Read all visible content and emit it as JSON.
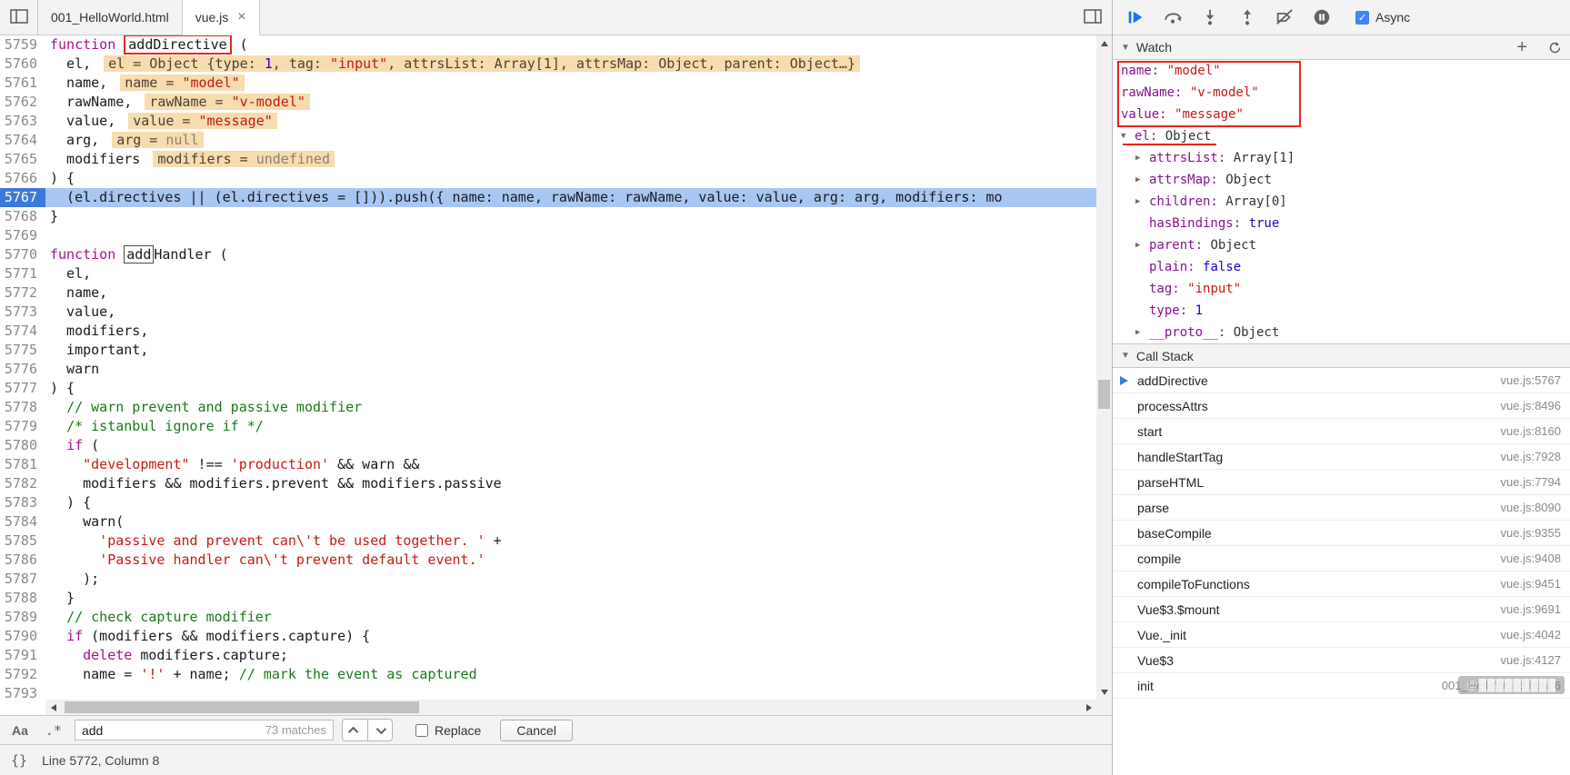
{
  "colors": {
    "annotation_red": "#E8271C",
    "execution_line_blue": "#A8C6F2",
    "current_line_gutter_blue": "#3D79D9",
    "resume_blue": "#1A73E8",
    "inline_hint_tan": "#F7DCAE"
  },
  "tabs": {
    "items": [
      {
        "label": "001_HelloWorld.html",
        "active": false
      },
      {
        "label": "vue.js",
        "active": true,
        "close": "×"
      }
    ]
  },
  "editor": {
    "current_line": 5767,
    "lines": [
      {
        "n": 5759,
        "seg": [
          [
            "function",
            "k"
          ],
          [
            " ",
            "d"
          ],
          [
            "addDirective",
            "annbox"
          ],
          [
            " (",
            "d"
          ]
        ]
      },
      {
        "n": 5760,
        "seg": [
          [
            "  el,",
            "d"
          ]
        ],
        "hint": [
          [
            "el = Object {type: ",
            "hd"
          ],
          [
            "1",
            "hn"
          ],
          [
            ", tag: ",
            "hd"
          ],
          [
            "\"input\"",
            "hs"
          ],
          [
            ", attrsList: Array[1], attrsMap: Object, parent: Object…}",
            "hd"
          ]
        ]
      },
      {
        "n": 5761,
        "seg": [
          [
            "  name,",
            "d"
          ]
        ],
        "hint": [
          [
            "name = ",
            "hd"
          ],
          [
            "\"model\"",
            "hs"
          ]
        ]
      },
      {
        "n": 5762,
        "seg": [
          [
            "  rawName,",
            "d"
          ]
        ],
        "hint": [
          [
            "rawName = ",
            "hd"
          ],
          [
            "\"v-model\"",
            "hs"
          ]
        ]
      },
      {
        "n": 5763,
        "seg": [
          [
            "  value,",
            "d"
          ]
        ],
        "hint": [
          [
            "value = ",
            "hd"
          ],
          [
            "\"message\"",
            "hs"
          ]
        ]
      },
      {
        "n": 5764,
        "seg": [
          [
            "  arg,",
            "d"
          ]
        ],
        "hint": [
          [
            "arg = ",
            "hd"
          ],
          [
            "null",
            "hg"
          ]
        ]
      },
      {
        "n": 5765,
        "seg": [
          [
            "  modifiers",
            "d"
          ]
        ],
        "hint": [
          [
            "modifiers = ",
            "hd"
          ],
          [
            "undefined",
            "hg"
          ]
        ]
      },
      {
        "n": 5766,
        "seg": [
          [
            ") {",
            "d"
          ]
        ]
      },
      {
        "n": 5767,
        "hl": true,
        "seg": [
          [
            "  (el.directives || (el.directives = [])).push({ name: name, rawName: rawName, value: value, arg: arg, modifiers: mo",
            "d"
          ]
        ]
      },
      {
        "n": 5768,
        "seg": [
          [
            "}",
            "d"
          ]
        ]
      },
      {
        "n": 5769,
        "seg": []
      },
      {
        "n": 5770,
        "seg": [
          [
            "function",
            "k"
          ],
          [
            " ",
            "d"
          ],
          [
            "add",
            "ring"
          ],
          [
            "Handler (",
            "d"
          ]
        ]
      },
      {
        "n": 5771,
        "seg": [
          [
            "  el,",
            "d"
          ]
        ]
      },
      {
        "n": 5772,
        "seg": [
          [
            "  name,",
            "d"
          ]
        ]
      },
      {
        "n": 5773,
        "seg": [
          [
            "  value,",
            "d"
          ]
        ]
      },
      {
        "n": 5774,
        "seg": [
          [
            "  modifiers,",
            "d"
          ]
        ]
      },
      {
        "n": 5775,
        "seg": [
          [
            "  important,",
            "d"
          ]
        ]
      },
      {
        "n": 5776,
        "seg": [
          [
            "  warn",
            "d"
          ]
        ]
      },
      {
        "n": 5777,
        "seg": [
          [
            ") {",
            "d"
          ]
        ]
      },
      {
        "n": 5778,
        "seg": [
          [
            "  ",
            "d"
          ],
          [
            "// warn prevent and passive modifier",
            "c"
          ]
        ]
      },
      {
        "n": 5779,
        "seg": [
          [
            "  ",
            "d"
          ],
          [
            "/* istanbul ignore if */",
            "c"
          ]
        ]
      },
      {
        "n": 5780,
        "seg": [
          [
            "  ",
            "d"
          ],
          [
            "if",
            "k"
          ],
          [
            " (",
            "d"
          ]
        ]
      },
      {
        "n": 5781,
        "seg": [
          [
            "    ",
            "d"
          ],
          [
            "\"development\"",
            "s"
          ],
          [
            " !== ",
            "d"
          ],
          [
            "'production'",
            "s"
          ],
          [
            " && warn &&",
            "d"
          ]
        ]
      },
      {
        "n": 5782,
        "seg": [
          [
            "    modifiers && modifiers.prevent && modifiers.passive",
            "d"
          ]
        ]
      },
      {
        "n": 5783,
        "seg": [
          [
            "  ) {",
            "d"
          ]
        ]
      },
      {
        "n": 5784,
        "seg": [
          [
            "    warn(",
            "d"
          ]
        ]
      },
      {
        "n": 5785,
        "seg": [
          [
            "      ",
            "d"
          ],
          [
            "'passive and prevent can\\'t be used together. '",
            "s"
          ],
          [
            " +",
            "d"
          ]
        ]
      },
      {
        "n": 5786,
        "seg": [
          [
            "      ",
            "d"
          ],
          [
            "'Passive handler can\\'t prevent default event.'",
            "s"
          ]
        ]
      },
      {
        "n": 5787,
        "seg": [
          [
            "    );",
            "d"
          ]
        ]
      },
      {
        "n": 5788,
        "seg": [
          [
            "  }",
            "d"
          ]
        ]
      },
      {
        "n": 5789,
        "seg": [
          [
            "  ",
            "d"
          ],
          [
            "// check capture modifier",
            "c"
          ]
        ]
      },
      {
        "n": 5790,
        "seg": [
          [
            "  ",
            "d"
          ],
          [
            "if",
            "k"
          ],
          [
            " (modifiers && modifiers.capture) {",
            "d"
          ]
        ]
      },
      {
        "n": 5791,
        "seg": [
          [
            "    ",
            "d"
          ],
          [
            "delete",
            "k"
          ],
          [
            " modifiers.capture;",
            "d"
          ]
        ]
      },
      {
        "n": 5792,
        "seg": [
          [
            "    name = ",
            "d"
          ],
          [
            "'!'",
            "s"
          ],
          [
            " + name; ",
            "d"
          ],
          [
            "// mark the event as captured",
            "c"
          ]
        ]
      },
      {
        "n": 5793,
        "seg": []
      }
    ]
  },
  "find_bar": {
    "match_case": "Aa",
    "regex": ".*",
    "query": "add",
    "matches": "73 matches",
    "replace_label": "Replace",
    "replace_checked": false,
    "cancel_label": "Cancel"
  },
  "status_bar": {
    "pretty_print": "{}",
    "position": "Line 5772, Column 8"
  },
  "debug_toolbar": {
    "async_label": "Async",
    "async_checked": true,
    "icons": [
      "resume-icon",
      "step-over-icon",
      "step-into-icon",
      "step-out-icon",
      "deactivate-breakpoints-icon",
      "pause-on-exceptions-icon"
    ]
  },
  "watch": {
    "title": "Watch",
    "items": [
      {
        "name": "name",
        "value": "\"model\"",
        "vtype": "str",
        "depth": 0
      },
      {
        "name": "rawName",
        "value": "\"v-model\"",
        "vtype": "str",
        "depth": 0
      },
      {
        "name": "value",
        "value": "\"message\"",
        "vtype": "str",
        "depth": 0
      },
      {
        "name": "el",
        "value": "Object",
        "vtype": "obj",
        "depth": 0,
        "expand": "open"
      },
      {
        "name": "attrsList",
        "value": "Array[1]",
        "vtype": "obj",
        "depth": 1,
        "expand": "closed"
      },
      {
        "name": "attrsMap",
        "value": "Object",
        "vtype": "obj",
        "depth": 1,
        "expand": "closed"
      },
      {
        "name": "children",
        "value": "Array[0]",
        "vtype": "obj",
        "depth": 1,
        "expand": "closed"
      },
      {
        "name": "hasBindings",
        "value": "true",
        "vtype": "bool",
        "depth": 1
      },
      {
        "name": "parent",
        "value": "Object",
        "vtype": "obj",
        "depth": 1,
        "expand": "closed"
      },
      {
        "name": "plain",
        "value": "false",
        "vtype": "bool",
        "depth": 1
      },
      {
        "name": "tag",
        "value": "\"input\"",
        "vtype": "str",
        "depth": 1
      },
      {
        "name": "type",
        "value": "1",
        "vtype": "num",
        "depth": 1
      },
      {
        "name": "__proto__",
        "value": "Object",
        "vtype": "obj",
        "depth": 1,
        "expand": "closed"
      }
    ]
  },
  "call_stack": {
    "title": "Call Stack",
    "frames": [
      {
        "fn": "addDirective",
        "loc": "vue.js:5767",
        "current": true
      },
      {
        "fn": "processAttrs",
        "loc": "vue.js:8496"
      },
      {
        "fn": "start",
        "loc": "vue.js:8160"
      },
      {
        "fn": "handleStartTag",
        "loc": "vue.js:7928"
      },
      {
        "fn": "parseHTML",
        "loc": "vue.js:7794"
      },
      {
        "fn": "parse",
        "loc": "vue.js:8090"
      },
      {
        "fn": "baseCompile",
        "loc": "vue.js:9355"
      },
      {
        "fn": "compile",
        "loc": "vue.js:9408"
      },
      {
        "fn": "compileToFunctions",
        "loc": "vue.js:9451"
      },
      {
        "fn": "Vue$3.$mount",
        "loc": "vue.js:9691"
      },
      {
        "fn": "Vue._init",
        "loc": "vue.js:4042"
      },
      {
        "fn": "Vue$3",
        "loc": "vue.js:4127"
      },
      {
        "fn": "init",
        "loc": "001_HelloWorld.html:6"
      }
    ]
  },
  "watermark": {
    "text": "@█████████"
  }
}
